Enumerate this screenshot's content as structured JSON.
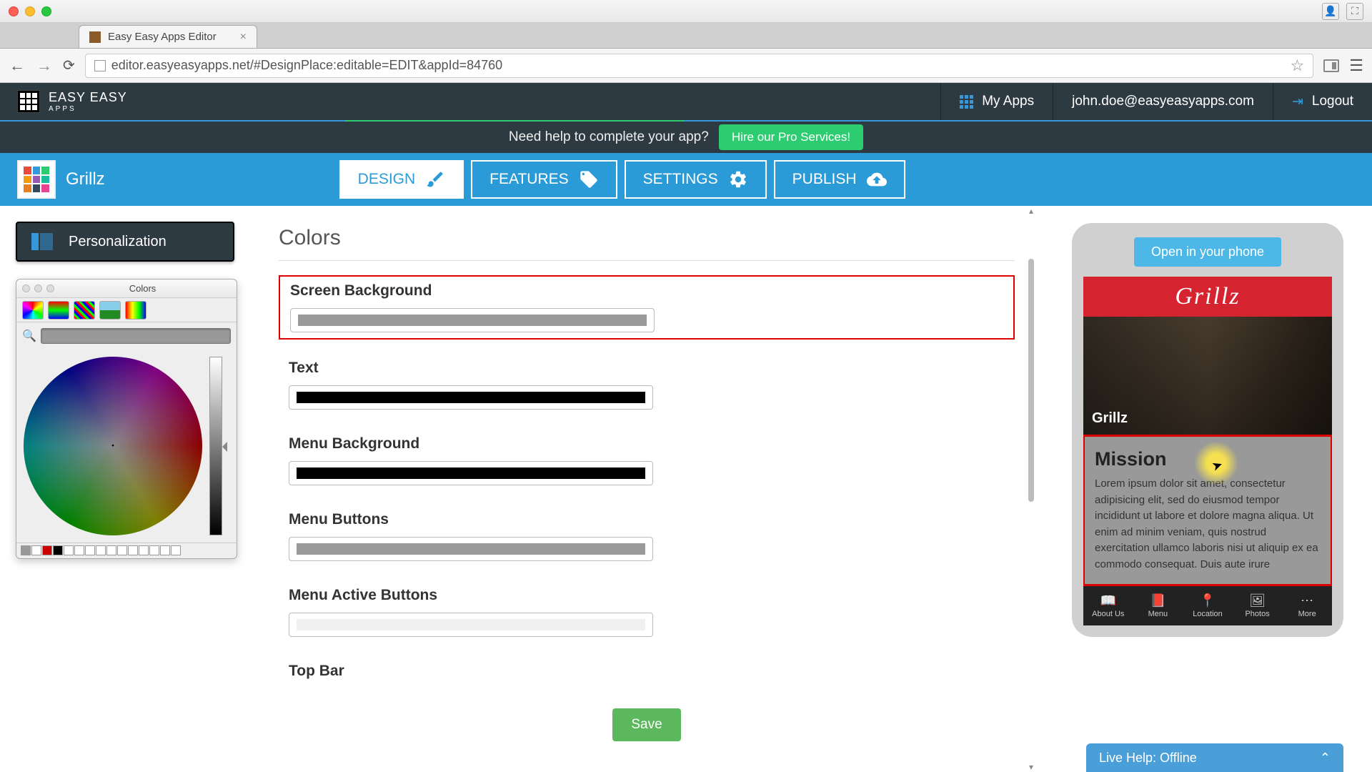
{
  "browser": {
    "tab_title": "Easy Easy Apps Editor",
    "url": "editor.easyeasyapps.net/#DesignPlace:editable=EDIT&appId=84760"
  },
  "topbar": {
    "brand_line1": "EASY EASY",
    "brand_line2": "APPS",
    "my_apps": "My Apps",
    "user_email": "john.doe@easyeasyapps.com",
    "logout": "Logout"
  },
  "help_banner": {
    "text": "Need help to complete your app?",
    "button": "Hire our Pro Services!"
  },
  "app_nav": {
    "app_name": "Grillz",
    "tabs": {
      "design": "DESIGN",
      "features": "FEATURES",
      "settings": "SETTINGS",
      "publish": "PUBLISH"
    }
  },
  "sidebar": {
    "personalization": "Personalization"
  },
  "color_picker": {
    "title": "Colors"
  },
  "editor": {
    "section_title": "Colors",
    "groups": {
      "screen_bg": {
        "label": "Screen Background",
        "color": "#9a9a9a"
      },
      "text": {
        "label": "Text",
        "color": "#000000"
      },
      "menu_bg": {
        "label": "Menu Background",
        "color": "#000000"
      },
      "menu_buttons": {
        "label": "Menu Buttons",
        "color": "#9a9a9a"
      },
      "menu_active": {
        "label": "Menu Active Buttons",
        "color": "#f0f0f0"
      },
      "top_bar": {
        "label": "Top Bar",
        "color": ""
      }
    },
    "save": "Save"
  },
  "preview": {
    "open_phone": "Open in your phone",
    "header": "Grillz",
    "hero_caption": "Grillz",
    "mission_title": "Mission",
    "mission_body": "Lorem ipsum dolor sit amet, consectetur adipisicing elit, sed do eiusmod tempor incididunt ut labore et dolore magna aliqua. Ut enim ad minim veniam, quis nostrud exercitation ullamco laboris nisi ut aliquip ex ea commodo consequat. Duis aute irure",
    "tabs": {
      "about": "About Us",
      "menu": "Menu",
      "location": "Location",
      "photos": "Photos",
      "more": "More"
    }
  },
  "live_help": "Live Help: Offline"
}
